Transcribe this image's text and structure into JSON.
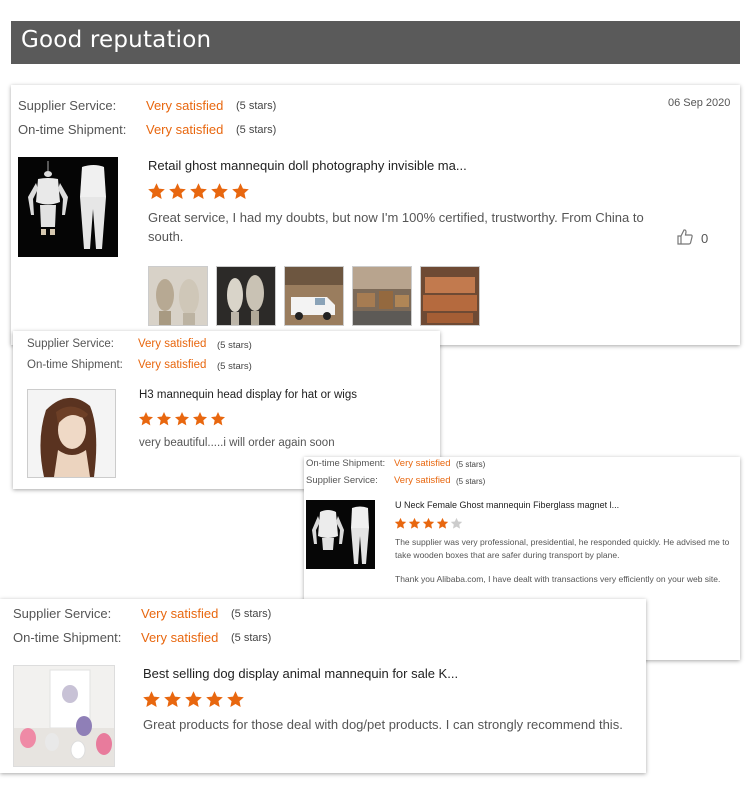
{
  "header": {
    "title": "Good reputation"
  },
  "reviews": [
    {
      "supplier_label": "Supplier Service:",
      "supplier_value": "Very satisfied",
      "supplier_stars": "(5 stars)",
      "shipment_label": "On-time Shipment:",
      "shipment_value": "Very satisfied",
      "shipment_stars": "(5 stars)",
      "date": "06 Sep 2020",
      "product_title": "Retail ghost mannequin doll photography invisible ma...",
      "rating": 5,
      "text": "Great service, I had my doubts, but now I'm 100% certified, trustworthy. From China to south.",
      "likes": "0",
      "icon": "thumbs-up-icon"
    },
    {
      "supplier_label": "Supplier Service:",
      "supplier_value": "Very satisfied",
      "supplier_stars": "(5 stars)",
      "shipment_label": "On-time Shipment:",
      "shipment_value": "Very satisfied",
      "shipment_stars": "(5 stars)",
      "product_title": "H3 mannequin head display for hat or wigs",
      "rating": 5,
      "text": "very beautiful.....i will order again soon"
    },
    {
      "shipment_label": "On-time Shipment:",
      "shipment_value": "Very satisfied",
      "shipment_stars": "(5 stars)",
      "supplier_label": "Supplier Service:",
      "supplier_value": "Very satisfied",
      "supplier_stars": "(5 stars)",
      "product_title": "U Neck Female Ghost mannequin Fiberglass magnet l...",
      "rating": 4,
      "text": "The supplier was very professional, presidential, he responded quickly. He advised me to take wooden boxes that are safer during transport by plane.",
      "text2": "Thank you Alibaba.com, I have dealt with transactions very efficiently on your web site."
    },
    {
      "supplier_label": "Supplier Service:",
      "supplier_value": "Very satisfied",
      "supplier_stars": "(5 stars)",
      "shipment_label": "On-time Shipment:",
      "shipment_value": "Very satisfied",
      "shipment_stars": "(5 stars)",
      "product_title": "Best selling dog display animal mannequin for sale K...",
      "rating": 5,
      "text": "Great products for those deal with dog/pet products. I can strongly recommend this."
    }
  ],
  "colors": {
    "accent": "#e8670f",
    "header_bg": "#5a5a5a",
    "star_empty": "#cccccc"
  }
}
